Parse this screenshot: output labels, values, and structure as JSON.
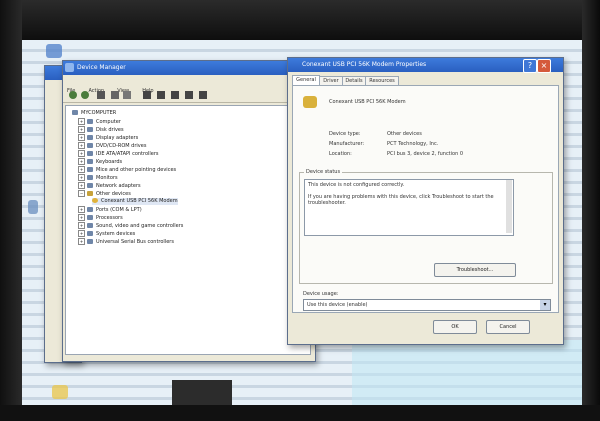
{
  "device_manager": {
    "title": "Device Manager",
    "menu": [
      "File",
      "Action",
      "View",
      "Help"
    ],
    "tree": {
      "root": "MYCOMPUTER",
      "categories": [
        "Computer",
        "Disk drives",
        "Display adapters",
        "DVD/CD-ROM drives",
        "IDE ATA/ATAPI controllers",
        "Keyboards",
        "Mice and other pointing devices",
        "Monitors",
        "Network adapters",
        "Other devices",
        "Conexant USB PCI 56K Modem",
        "Ports (COM & LPT)",
        "Processors",
        "Sound, video and game controllers",
        "System devices",
        "Universal Serial Bus controllers"
      ]
    }
  },
  "properties": {
    "title": "Conexant USB PCI 56K Modem Properties",
    "tabs": [
      "General",
      "Driver",
      "Details",
      "Resources"
    ],
    "device_name": "Conexant USB PCI 56K Modem",
    "device_type_label": "Device type:",
    "device_type_value": "Other devices",
    "manufacturer_label": "Manufacturer:",
    "manufacturer_value": "PCT Technology, Inc.",
    "location_label": "Location:",
    "location_value": "PCI bus 3, device 2, function 0",
    "status_group_label": "Device status",
    "status_line1": "This device is not configured correctly.",
    "status_line2": "If you are having problems with this device, click Troubleshoot to start the troubleshooter.",
    "troubleshoot_label": "Troubleshoot...",
    "usage_label": "Device usage:",
    "usage_value": "Use this device (enable)",
    "ok_label": "OK",
    "cancel_label": "Cancel"
  }
}
